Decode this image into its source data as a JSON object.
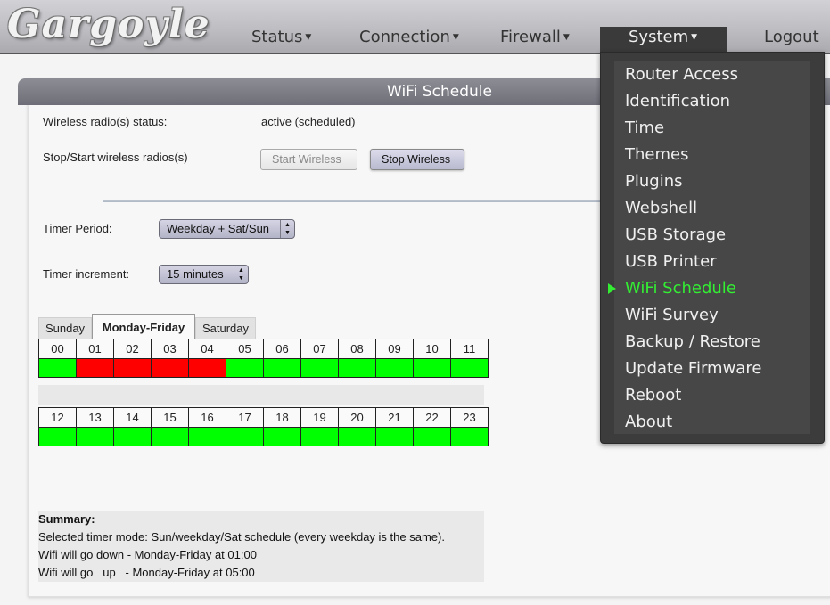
{
  "app": {
    "logo_text": "Gargoyle"
  },
  "nav": {
    "status": "Status",
    "connection": "Connection",
    "firewall": "Firewall",
    "system": "System",
    "logout": "Logout"
  },
  "panel": {
    "title": "WiFi Schedule",
    "radio_status_label": "Wireless radio(s) status:",
    "radio_status_value": "active (scheduled)",
    "stopstart_label": "Stop/Start wireless radios(s)",
    "start_button": "Start Wireless",
    "stop_button": "Stop Wireless",
    "timer_period_label": "Timer Period:",
    "timer_period_value": "Weekday + Sat/Sun",
    "timer_increment_label": "Timer increment:",
    "timer_increment_value": "15 minutes"
  },
  "day_tabs": [
    "Sunday",
    "Monday-Friday",
    "Saturday"
  ],
  "active_day_tab": "Monday-Friday",
  "schedule": {
    "hours_row1": [
      "00",
      "01",
      "02",
      "03",
      "04",
      "05",
      "06",
      "07",
      "08",
      "09",
      "10",
      "11"
    ],
    "hours_row2": [
      "12",
      "13",
      "14",
      "15",
      "16",
      "17",
      "18",
      "19",
      "20",
      "21",
      "22",
      "23"
    ],
    "wifi_off_hours": [
      "01",
      "02",
      "03",
      "04"
    ],
    "on_color": "#00ff00",
    "off_color": "#ff0000"
  },
  "summary": {
    "heading": "Summary:",
    "mode_line": "Selected timer mode: Sun/weekday/Sat schedule (every weekday is the same).",
    "down_line": "Wifi will go down - Monday-Friday at 01:00",
    "up_line": "Wifi will go   up   - Monday-Friday at 05:00"
  },
  "system_menu": {
    "items": [
      "Router Access",
      "Identification",
      "Time",
      "Themes",
      "Plugins",
      "Webshell",
      "USB Storage",
      "USB Printer",
      "WiFi Schedule",
      "WiFi Survey",
      "Backup / Restore",
      "Update Firmware",
      "Reboot",
      "About"
    ],
    "current": "WiFi Schedule",
    "current_color": "#33ee33"
  }
}
